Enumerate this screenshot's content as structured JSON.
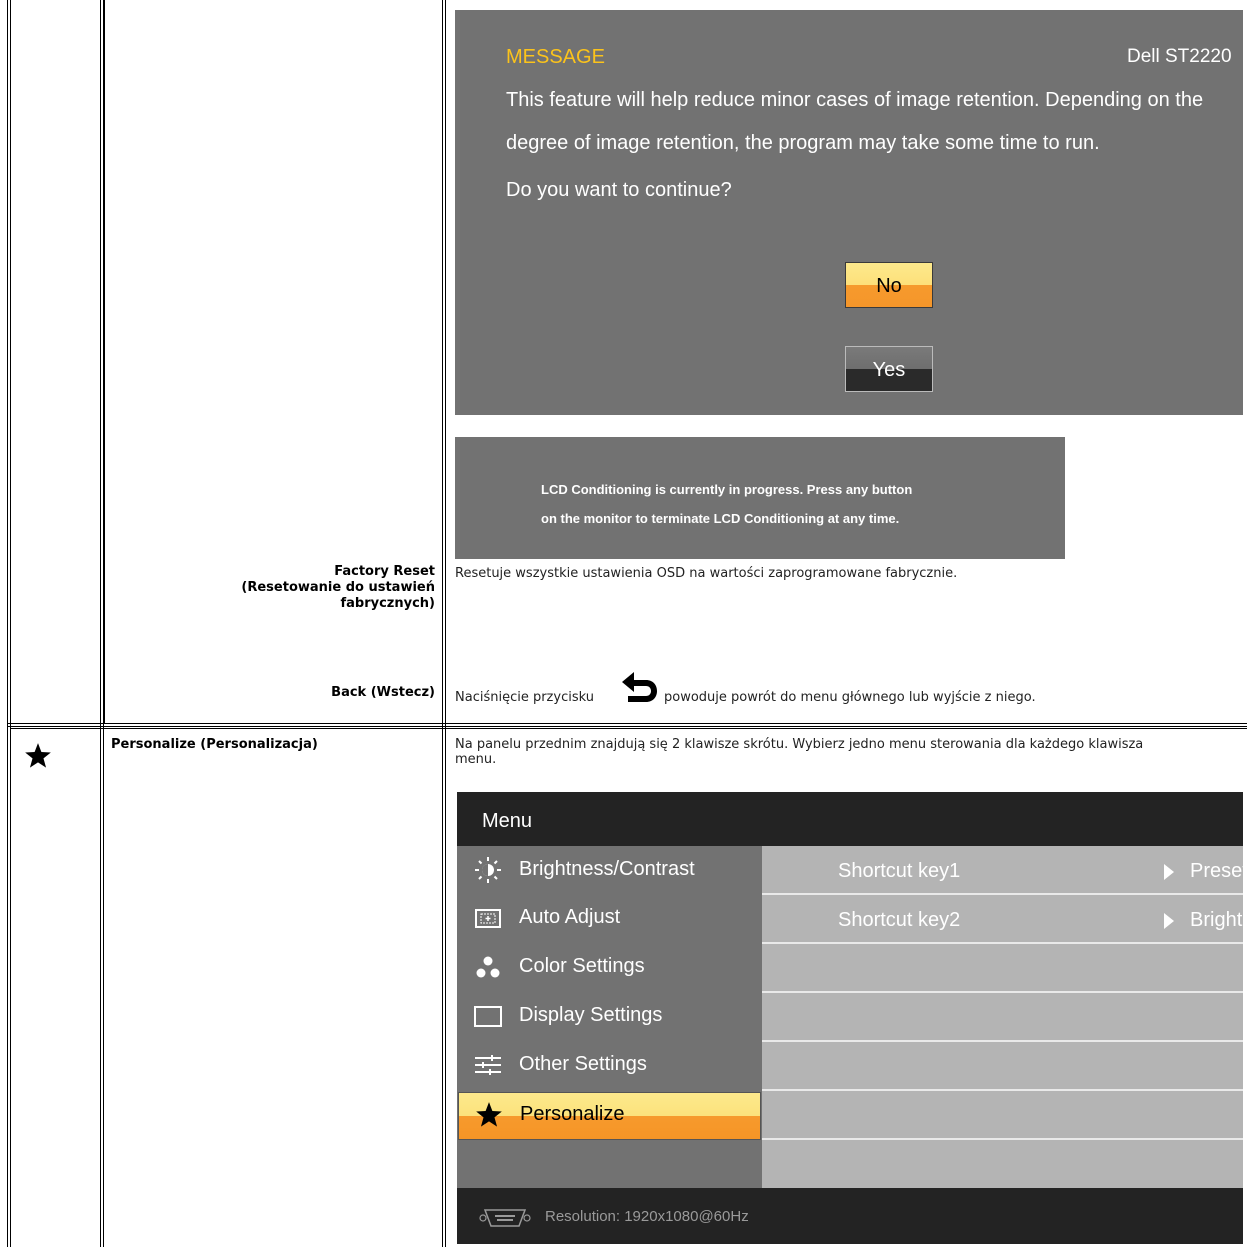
{
  "dialog_message": {
    "heading": "MESSAGE",
    "model": "Dell ST2220",
    "line1": "This feature will help reduce minor cases of image retention. Depending on the",
    "line2": "degree of image retention, the program may take some time to run.",
    "line3": "Do you want to continue?",
    "no_label": "No",
    "yes_label": "Yes"
  },
  "conditioning_box": {
    "line1": "LCD Conditioning is currently in progress. Press any button",
    "line2": "on the monitor to terminate LCD Conditioning at any time."
  },
  "factory_reset": {
    "label_line1": "Factory Reset",
    "label_line2": "(Resetowanie do ustawień",
    "label_line3": "fabrycznych)",
    "description": "Resetuje wszystkie ustawienia OSD na wartości zaprogramowane fabrycznie."
  },
  "back": {
    "label": "Back (Wstecz)",
    "description_before": "Naciśnięcie przycisku",
    "description_after": "powoduje powrót do menu głównego lub wyjście z niego."
  },
  "personalize": {
    "label": "Personalize (Personalizacja)",
    "description_line1": "Na panelu przednim znajdują się 2 klawisze skrótu. Wybierz jedno menu sterowania dla każdego klawisza",
    "description_line2": "menu."
  },
  "osd_menu": {
    "title": "Menu",
    "items": [
      {
        "label": "Brightness/Contrast",
        "icon": "brightness-icon"
      },
      {
        "label": "Auto Adjust",
        "icon": "auto-adjust-icon"
      },
      {
        "label": "Color Settings",
        "icon": "color-settings-icon"
      },
      {
        "label": "Display Settings",
        "icon": "display-settings-icon"
      },
      {
        "label": "Other Settings",
        "icon": "other-settings-icon"
      },
      {
        "label": "Personalize",
        "icon": "star-icon"
      }
    ],
    "selected_index": 5,
    "options": [
      {
        "key": "Shortcut key1",
        "value": "Preset Modes"
      },
      {
        "key": "Shortcut key2",
        "value": "Brightness/Contrast"
      }
    ],
    "resolution": "Resolution:  1920x1080@60Hz"
  },
  "colors": {
    "osd_gray": "#727272",
    "message_yellow": "#fbc31b",
    "selected_orange": "#f69a2d"
  }
}
